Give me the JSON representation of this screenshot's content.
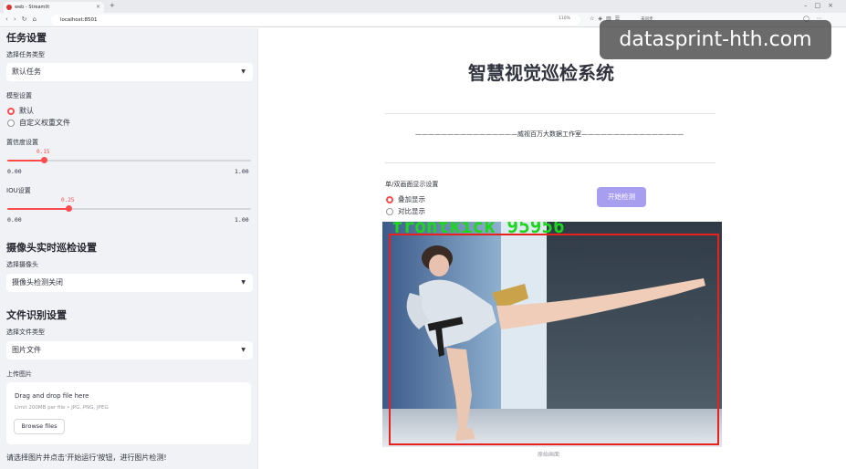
{
  "browser": {
    "tab_title": "web - Streamlit",
    "url": "localhost:8501",
    "zoom": "110%",
    "toolbar_label": "未同步"
  },
  "sidebar": {
    "task_section": {
      "title": "任务设置",
      "type_label": "选择任务类型",
      "type_value": "默认任务"
    },
    "model_label": "模型设置",
    "model_options": [
      "默认",
      "自定义权重文件"
    ],
    "conf": {
      "label": "置信度设置",
      "value": "0.15",
      "fraction": 0.15,
      "min": "0.00",
      "max": "1.00"
    },
    "iou": {
      "label": "IOU设置",
      "value": "0.25",
      "fraction": 0.25,
      "min": "0.00",
      "max": "1.00"
    },
    "camera_section": {
      "title": "摄像头实时巡检设置",
      "label": "选择摄像头",
      "value": "摄像头检测关闭"
    },
    "file_section": {
      "title": "文件识别设置",
      "type_label": "选择文件类型",
      "type_value": "图片文件",
      "upload_label": "上传图片",
      "drop_text": "Drag and drop file here",
      "limit_text": "Limit 200MB per file • JPG, PNG, JPEG",
      "browse_label": "Browse files"
    },
    "hint": "请选择图片并点击'开始运行'按钮，进行图片检测!"
  },
  "main": {
    "title": "智慧视觉巡检系统",
    "subtitle": "————————————————威视百万大数据工作室————————————————",
    "display_label": "单/双画面显示设置",
    "display_options": [
      "叠加显示",
      "对比显示"
    ],
    "start_button": "开始检测",
    "detection_label": "frontkick  95956",
    "caption": "原始画面"
  },
  "watermark": "datasprint-hth.com",
  "colors": {
    "accent": "#ff4b4b",
    "button": "#a89ef0",
    "sidebar_bg": "#f0f2f6",
    "detection_box": "#e8201e",
    "detection_text": "#1fd61f"
  }
}
